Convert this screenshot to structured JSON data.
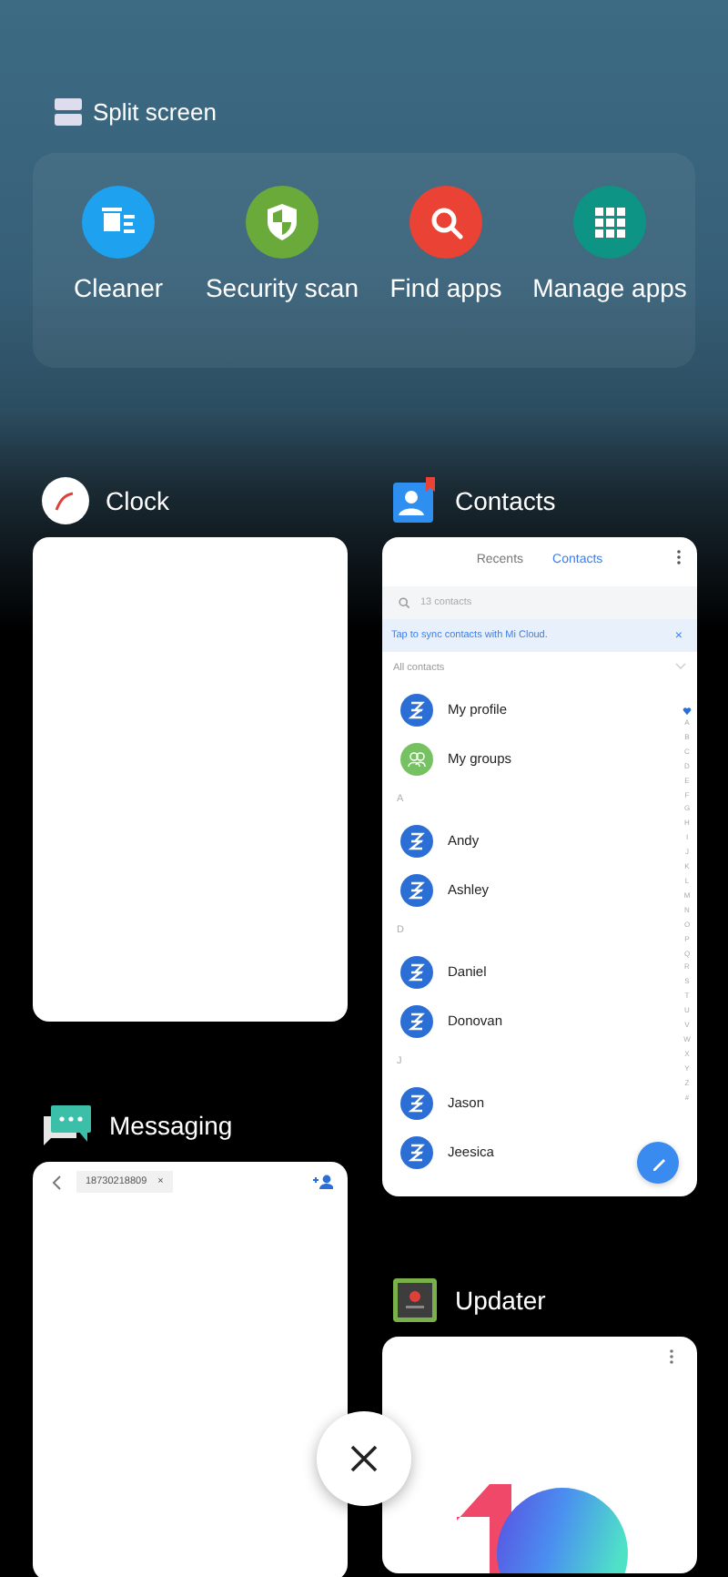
{
  "split_screen": {
    "label": "Split screen"
  },
  "shortcuts": [
    {
      "kind": "cleaner",
      "label": "Cleaner"
    },
    {
      "kind": "security",
      "label": "Security scan"
    },
    {
      "kind": "find",
      "label": "Find apps"
    },
    {
      "kind": "manage",
      "label": "Manage apps"
    }
  ],
  "recent_apps": [
    {
      "kind": "clock",
      "name": "Clock"
    },
    {
      "kind": "contacts",
      "name": "Contacts",
      "tabs": [
        {
          "label": "Recents",
          "selected": false
        },
        {
          "label": "Contacts",
          "selected": true
        }
      ],
      "search": {
        "placeholder": "13 contacts"
      },
      "banner": {
        "text": "Tap to sync contacts with Mi Cloud.",
        "close": "×"
      },
      "section": "All contacts",
      "rows": [
        {
          "kind": "profile",
          "text": "My profile"
        },
        {
          "kind": "group",
          "text": "My groups"
        },
        {
          "kind": "header",
          "text": "A"
        },
        {
          "kind": "contact",
          "text": "Andy"
        },
        {
          "kind": "contact",
          "text": "Ashley"
        },
        {
          "kind": "header",
          "text": "D"
        },
        {
          "kind": "contact",
          "text": "Daniel"
        },
        {
          "kind": "contact",
          "text": "Donovan"
        },
        {
          "kind": "header",
          "text": "J"
        },
        {
          "kind": "contact",
          "text": "Jason"
        },
        {
          "kind": "contact",
          "text": "Jeesica"
        }
      ],
      "index": [
        "A",
        "B",
        "C",
        "D",
        "E",
        "F",
        "G",
        "H",
        "I",
        "J",
        "K",
        "L",
        "M",
        "N",
        "O",
        "P",
        "Q",
        "R",
        "S",
        "T",
        "U",
        "V",
        "W",
        "X",
        "Y",
        "Z",
        "#"
      ]
    },
    {
      "kind": "messaging",
      "name": "Messaging",
      "recipient": "18730218809",
      "remove": "×"
    },
    {
      "kind": "updater",
      "name": "Updater"
    }
  ]
}
